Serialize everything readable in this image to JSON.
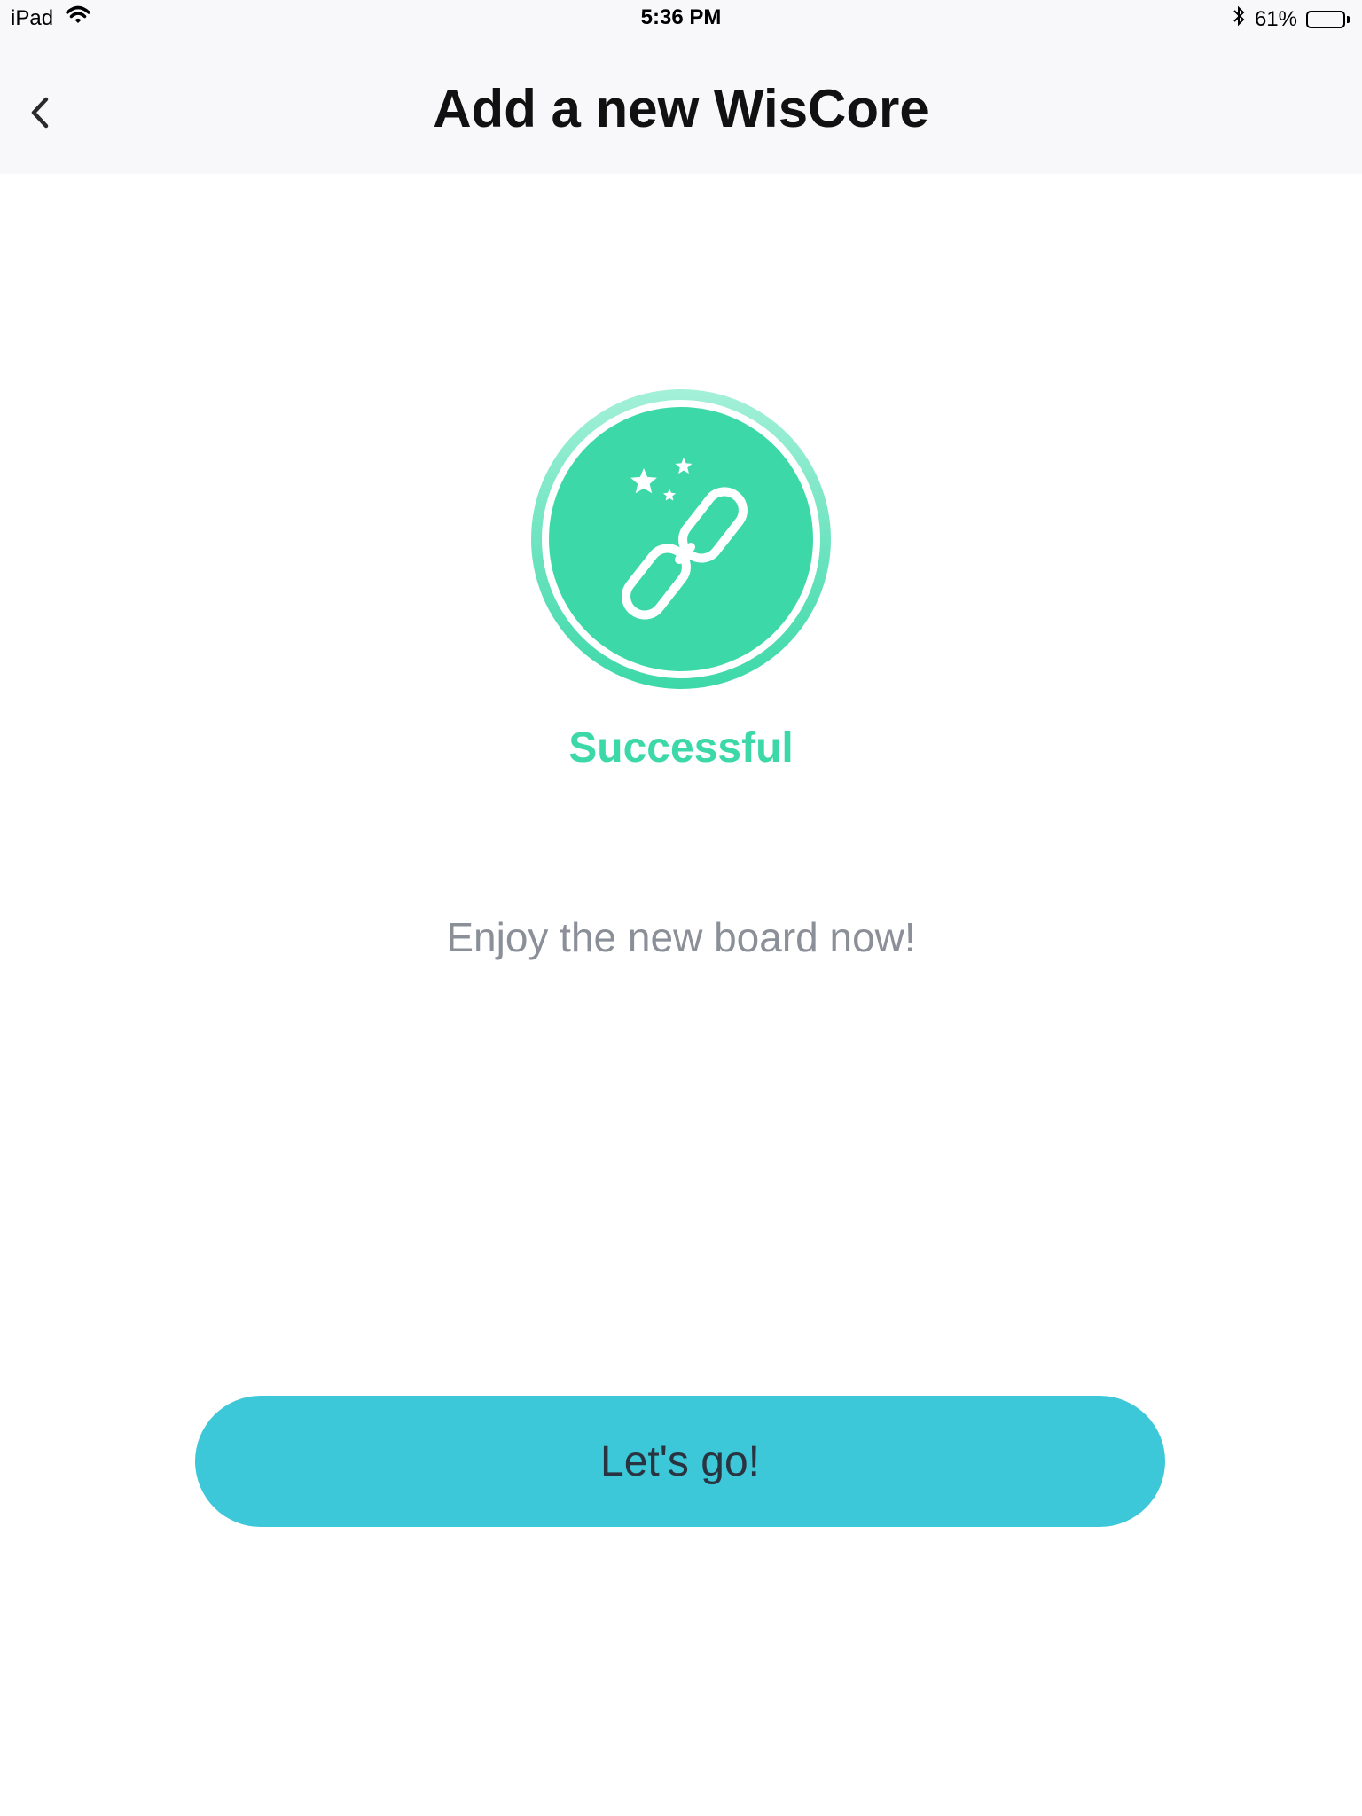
{
  "status_bar": {
    "device": "iPad",
    "time": "5:36 PM",
    "battery_percent": "61%",
    "battery_level": 0.61,
    "icons": [
      "wifi-icon",
      "bluetooth-icon",
      "battery-icon"
    ]
  },
  "nav": {
    "title": "Add a new WisCore",
    "back_icon": "chevron-left-icon"
  },
  "result": {
    "icon": "link-chain-icon",
    "decorations": "stars-icon",
    "status": "Successful",
    "message": "Enjoy the new board now!"
  },
  "actions": {
    "primary_label": "Let's go!"
  },
  "colors": {
    "success_green": "#3cd8a8",
    "button_cyan": "#3cc8d8",
    "nav_background": "#f8f8fa"
  }
}
